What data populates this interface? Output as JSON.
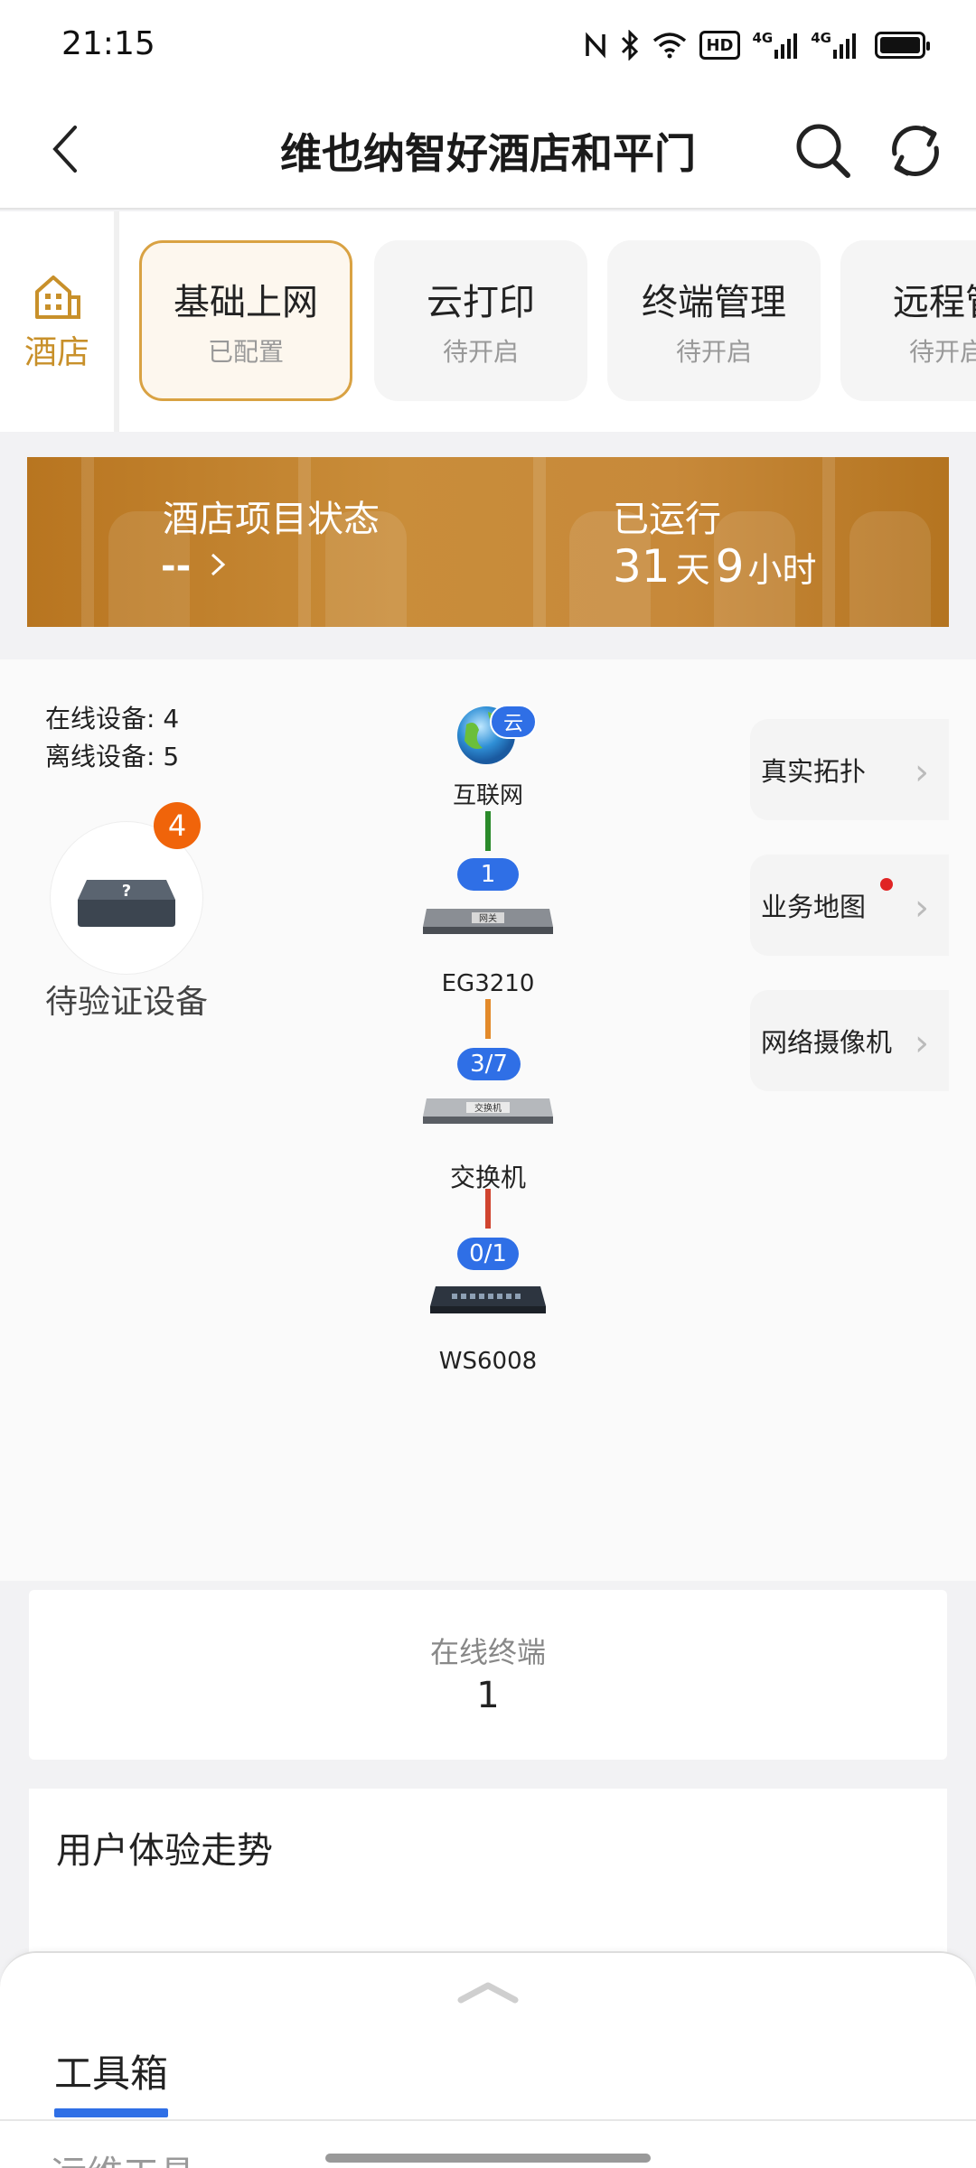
{
  "status_bar": {
    "time": "21:15",
    "network_a": "4G",
    "network_b": "4G",
    "hd_label": "HD"
  },
  "header": {
    "title": "维也纳智好酒店和平门"
  },
  "category": {
    "label": "酒店"
  },
  "modules": [
    {
      "title": "基础上网",
      "status": "已配置",
      "active": true
    },
    {
      "title": "云打印",
      "status": "待开启",
      "active": false
    },
    {
      "title": "终端管理",
      "status": "待开启",
      "active": false
    },
    {
      "title": "远程管",
      "status": "待开启",
      "active": false
    }
  ],
  "banner": {
    "status_label": "酒店项目状态",
    "status_value": "--",
    "run_label": "已运行",
    "run_days_num": "31",
    "run_days_unit": "天",
    "run_hours_num": "9",
    "run_hours_unit": "小时"
  },
  "topology": {
    "online_devices": "在线设备: 4",
    "offline_devices": "离线设备: 5",
    "pending_count": "4",
    "pending_label": "待验证设备",
    "cloud_badge": "云",
    "internet_label": "互联网",
    "gateway_tag": "网关",
    "switch_tag": "交换机",
    "nodes": [
      {
        "label": "EG3210"
      },
      {
        "label": "交换机"
      },
      {
        "label": "WS6008"
      }
    ],
    "ports": [
      "1",
      "3/7",
      "0/1"
    ],
    "link_colors": [
      "#2a8a2a",
      "#e38a2a",
      "#d0442f"
    ]
  },
  "side_buttons": [
    {
      "label": "真实拓扑"
    },
    {
      "label": "业务地图",
      "has_dot": true
    },
    {
      "label": "网络摄像机"
    }
  ],
  "online_terminals": {
    "label": "在线终端",
    "value": "1"
  },
  "ux_trend": {
    "title": "用户体验走势"
  },
  "sheet": {
    "tab": "工具箱",
    "section": "运维工具"
  },
  "colors": {
    "accent": "#d9a243",
    "brand_blue": "#2f6fe6",
    "badge_orange": "#f0640a"
  }
}
